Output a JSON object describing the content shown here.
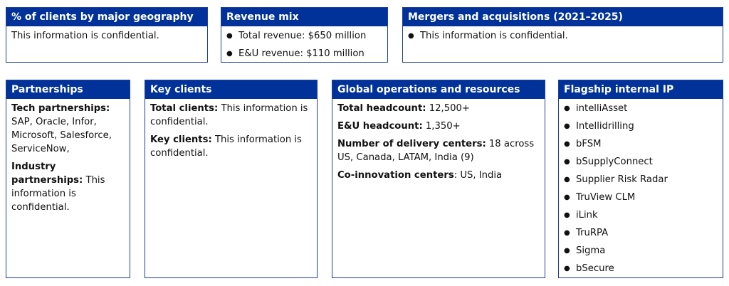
{
  "cards": {
    "geography": {
      "title": "% of clients by major geography",
      "text": "This information is confidential."
    },
    "revenue": {
      "title": "Revenue mix",
      "items": [
        "Total revenue: $650 million",
        "E&U revenue: $110 million"
      ]
    },
    "mna": {
      "title": "Mergers and acquisitions (2021–2025)",
      "items": [
        "This information is confidential."
      ]
    },
    "partnerships": {
      "title": "Partnerships",
      "tech_label": "Tech partnerships:",
      "tech_value": "SAP, Oracle, Infor, Microsoft, Salesforce, ServiceNow,",
      "industry_label": "Industry partnerships:",
      "industry_value": "This information is confidential."
    },
    "key_clients": {
      "title": "Key clients",
      "total_label": "Total clients:",
      "total_value": "This information is confidential.",
      "key_label": "Key clients:",
      "key_value": "This information is confidential."
    },
    "global_ops": {
      "title": "Global operations and resources",
      "headcount_label": "Total headcount:",
      "headcount_value": "12,500+",
      "eu_label": "E&U headcount:",
      "eu_value": "1,350+",
      "delivery_label": "Number of delivery centers:",
      "delivery_value": "18 across US, Canada, LATAM, India (9)",
      "coinnov_label": "Co-innovation centers",
      "coinnov_value": ": US, India"
    },
    "flagship_ip": {
      "title": "Flagship internal IP",
      "items": [
        "intelliAsset",
        "Intellidrilling",
        "bFSM",
        "bSupplyConnect",
        "Supplier Risk Radar",
        "TruView CLM",
        "iLink",
        "TruRPA",
        "Sigma",
        "bSecure"
      ]
    }
  },
  "colors": {
    "header_bg": "#00329a",
    "border": "#1f3d9e"
  }
}
